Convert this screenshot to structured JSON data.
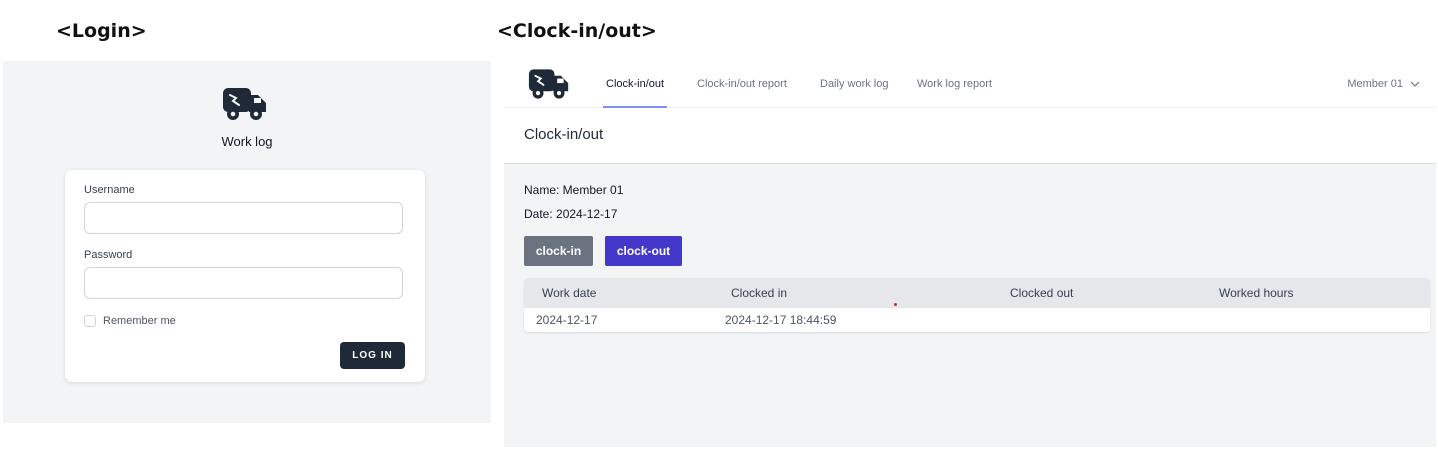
{
  "labels": {
    "login": "<Login>",
    "clock": "<Clock-in/out>"
  },
  "login": {
    "app_name": "Work log",
    "username_label": "Username",
    "username_value": "",
    "password_label": "Password",
    "password_value": "",
    "remember_label": "Remember me",
    "remember_checked": false,
    "button_label": "LOG IN"
  },
  "app": {
    "nav": {
      "tabs": [
        {
          "label": "Clock-in/out",
          "active": true
        },
        {
          "label": "Clock-in/out report",
          "active": false
        },
        {
          "label": "Daily work log",
          "active": false
        },
        {
          "label": "Work log report",
          "active": false
        }
      ],
      "user": "Member 01"
    },
    "page_title": "Clock-in/out",
    "name_line": "Name: Member 01",
    "date_line": "Date: 2024-12-17",
    "buttons": {
      "clock_in": "clock-in",
      "clock_out": "clock-out"
    },
    "table": {
      "headers": [
        "Work date",
        "Clocked in",
        "Clocked out",
        "Worked hours"
      ],
      "rows": [
        [
          "2024-12-17",
          "2024-12-17 18:44:59",
          "",
          ""
        ]
      ]
    }
  },
  "icons": {
    "logo": "truck-icon",
    "user_menu": "chevron-down-icon"
  },
  "colors": {
    "primary_button": "#4338ca",
    "secondary_button": "#6b7280",
    "dark_button": "#1f2937",
    "active_tab_underline": "#818cf8",
    "panel_background": "#f3f4f6"
  }
}
